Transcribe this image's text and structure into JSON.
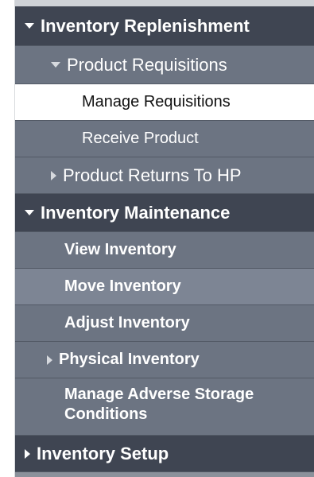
{
  "menu": {
    "inventory_replenishment": {
      "label": "Inventory Replenishment",
      "product_requisitions": {
        "label": "Product Requisitions",
        "items": [
          "Manage Requisitions",
          "Receive Product"
        ]
      },
      "product_returns": "Product Returns To HP"
    },
    "inventory_maintenance": {
      "label": "Inventory Maintenance",
      "items": [
        "View Inventory",
        "Move Inventory",
        "Adjust Inventory"
      ],
      "physical_inventory": "Physical Inventory",
      "adverse_storage": "Manage Adverse Storage Conditions"
    },
    "inventory_setup": "Inventory Setup",
    "active_item": "Manage Requisitions",
    "hovered_item": "Move Inventory"
  },
  "icons": {
    "expanded": "caret-down-icon",
    "collapsed": "caret-right-icon"
  },
  "colors": {
    "section_bg": "#3f4552",
    "item_bg": "#6c7482",
    "active_bg": "#ffffff",
    "hover_bg": "#7d8594"
  }
}
